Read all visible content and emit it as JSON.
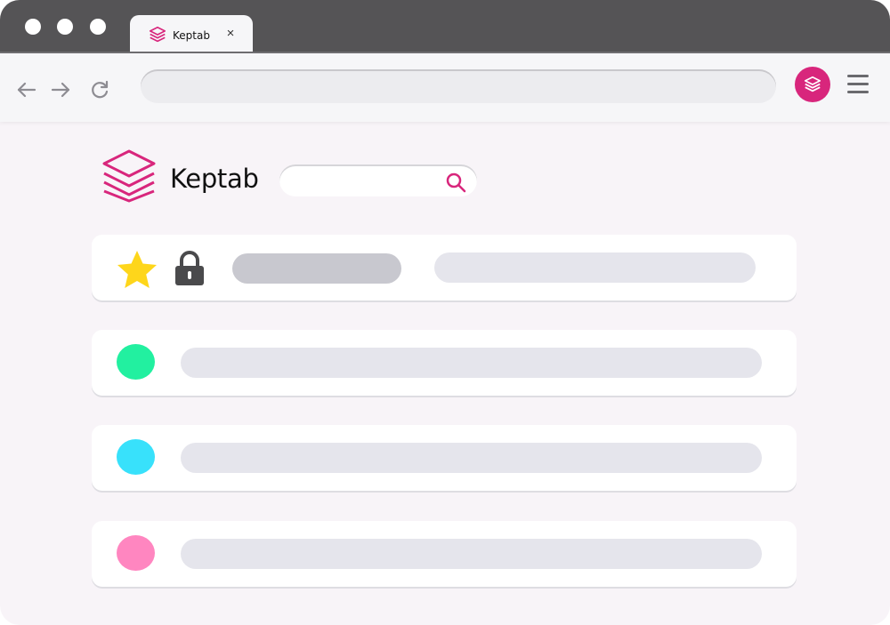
{
  "browser": {
    "tab": {
      "title": "Keptab",
      "close_glyph": "×",
      "icon": "layers-icon"
    },
    "address": {
      "value": "",
      "placeholder": ""
    },
    "nav": {
      "back_icon": "arrow-left-icon",
      "forward_icon": "arrow-right-icon",
      "reload_icon": "reload-icon"
    },
    "extension": {
      "icon": "layers-icon",
      "color": "#d8267c"
    },
    "menu_icon": "hamburger-menu-icon"
  },
  "page": {
    "brand": {
      "name": "Keptab",
      "logo_icon": "layers-icon",
      "accent": "#d8267c"
    },
    "search": {
      "value": "",
      "placeholder": "",
      "icon": "search-icon"
    },
    "rows": [
      {
        "kind": "pinned",
        "icons": [
          "star-icon",
          "lock-icon"
        ],
        "star_color": "#fed61b"
      },
      {
        "kind": "item",
        "dot_color": "#22f0a0"
      },
      {
        "kind": "item",
        "dot_color": "#38e1fb"
      },
      {
        "kind": "item",
        "dot_color": "#ff86c0"
      }
    ]
  }
}
